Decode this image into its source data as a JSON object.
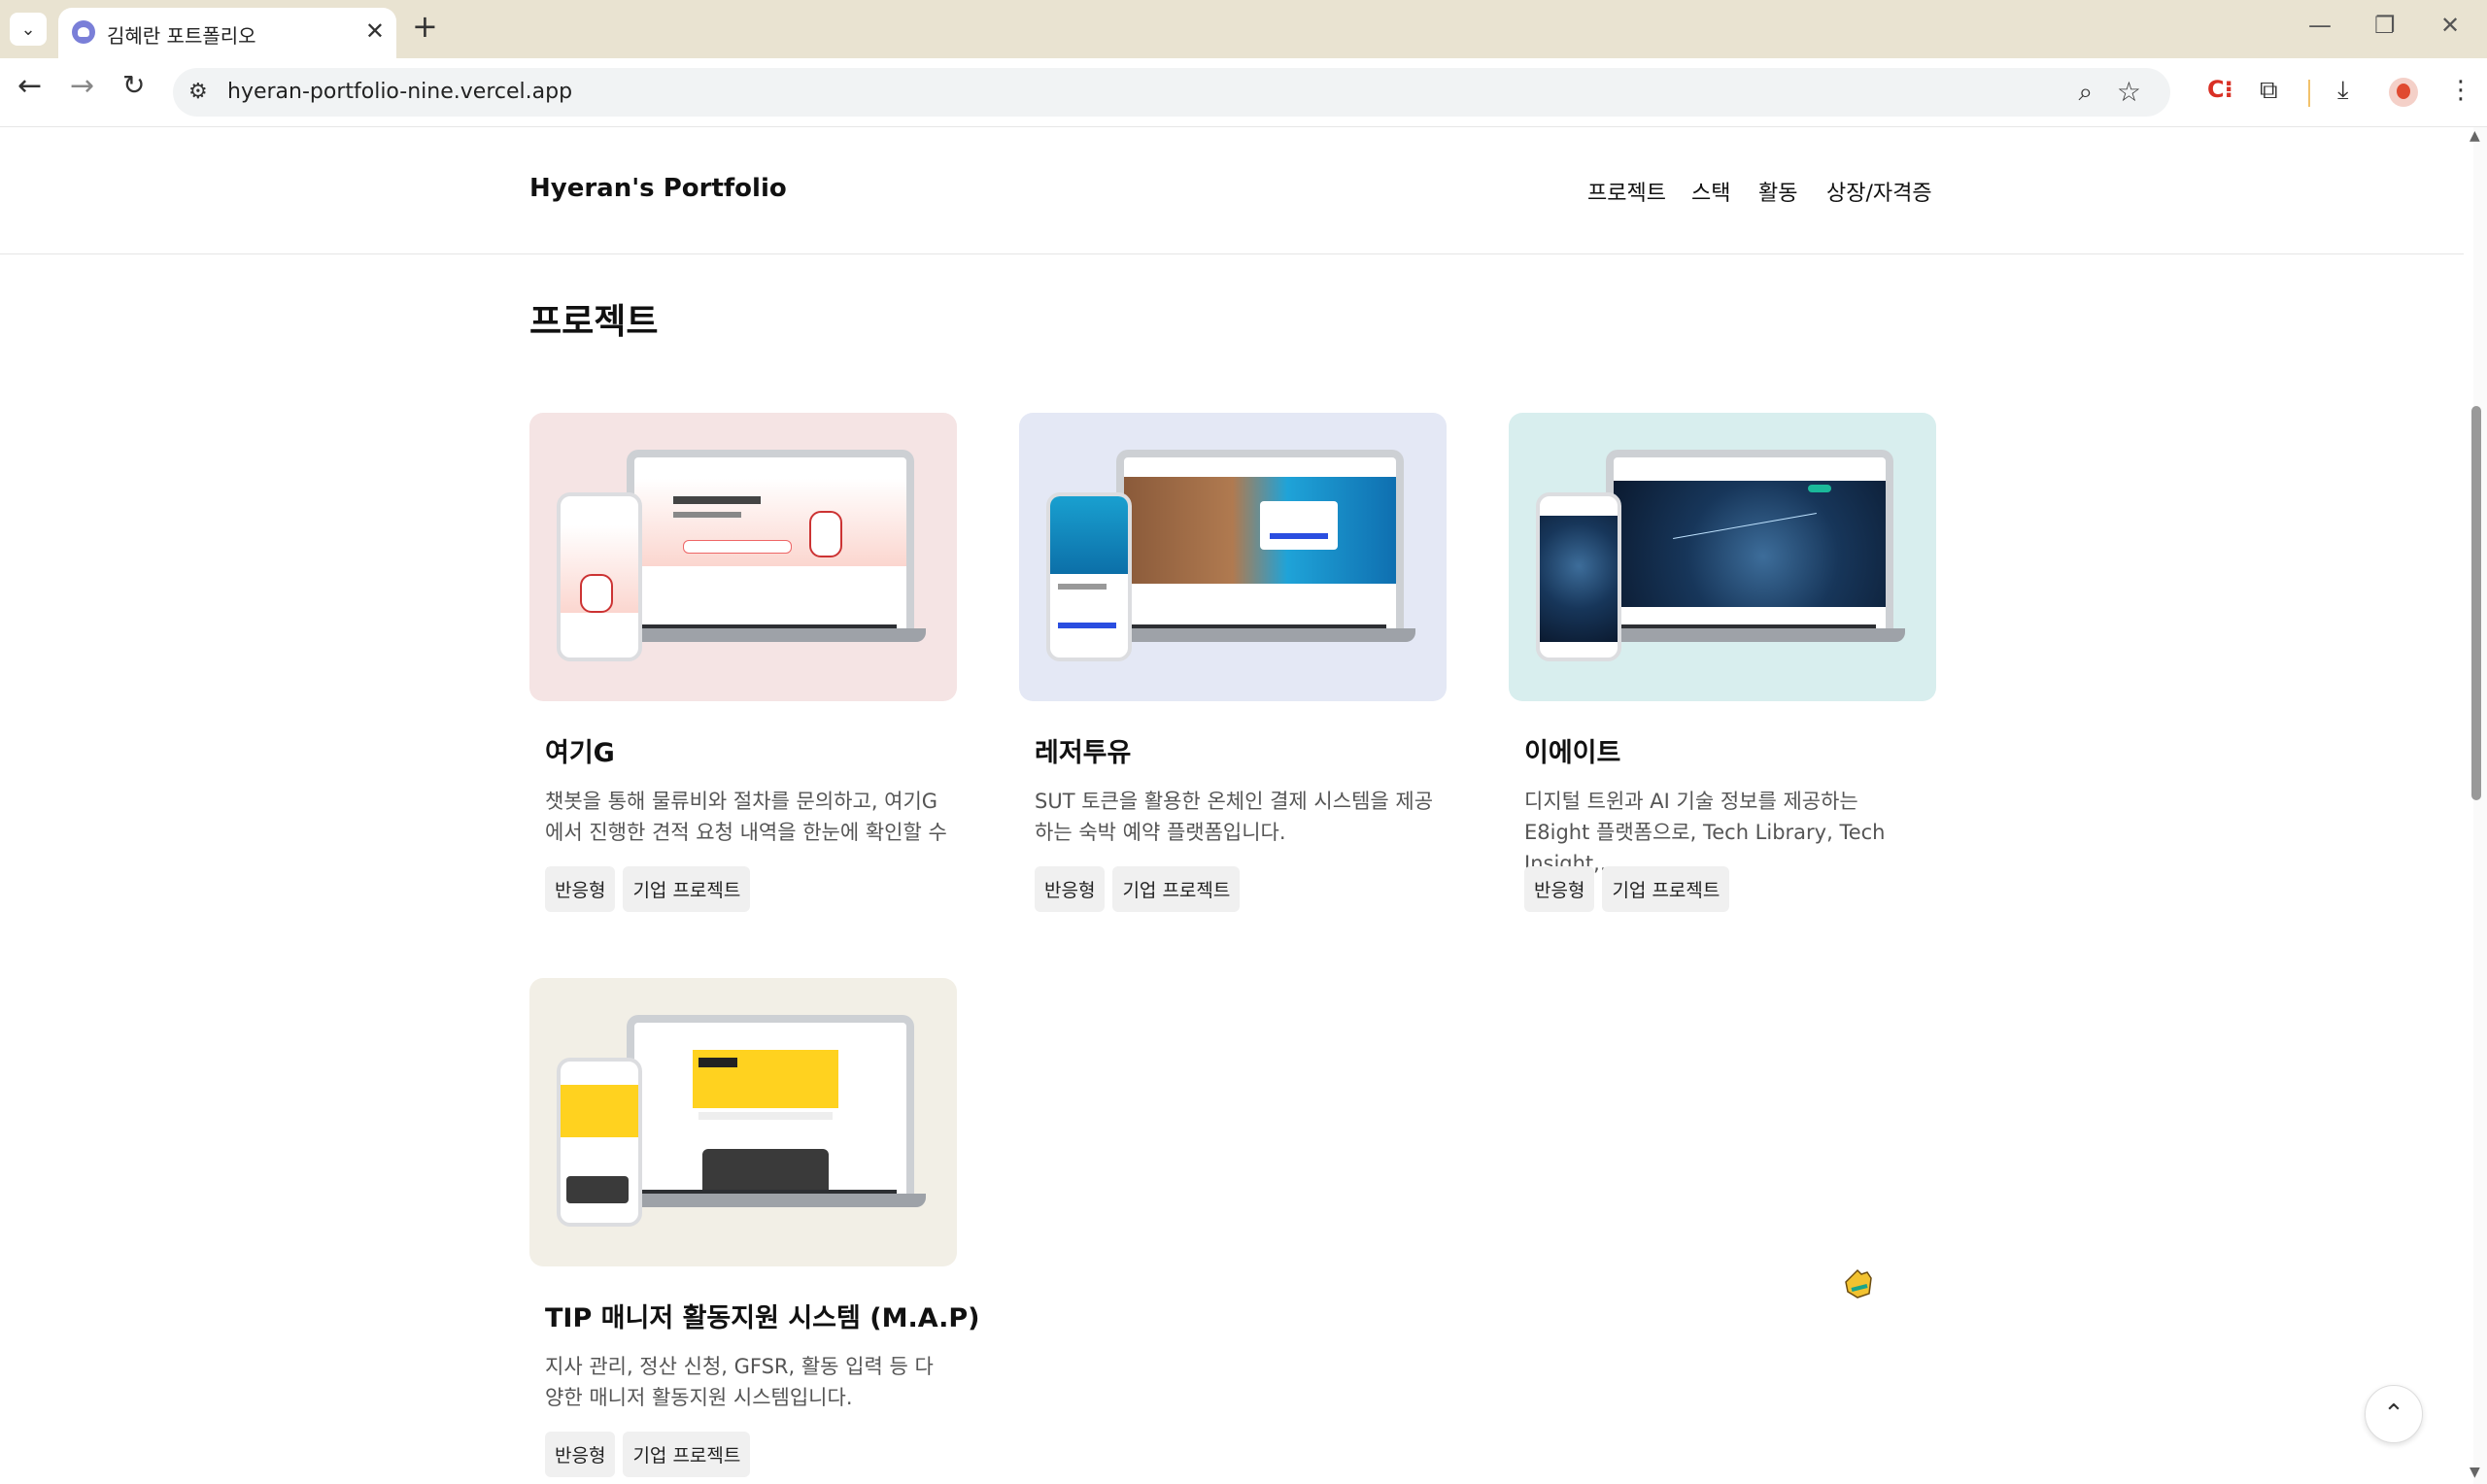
{
  "browser": {
    "tab_title": "김혜란 포트폴리오",
    "url": "hyeran-portfolio-nine.vercel.app",
    "icons": {
      "tab_menu": "chevron-down-icon",
      "close": "close-icon",
      "new_tab": "plus-icon",
      "back": "arrow-left-icon",
      "forward": "arrow-right-icon",
      "reload": "reload-icon",
      "site_info": "tune-icon",
      "zoom": "zoom-icon",
      "bookmark": "star-icon",
      "extensions": "puzzle-icon",
      "download": "download-icon",
      "menu": "kebab-menu-icon"
    }
  },
  "header": {
    "logo": "Hyeran's Portfolio",
    "nav": [
      "프로젝트",
      "스택",
      "활동",
      "상장/자격증"
    ]
  },
  "section": {
    "title": "프로젝트"
  },
  "projects": [
    {
      "title": "여기G",
      "description": "챗봇을 통해 물류비와 절차를 문의하고, 여기G에서 진행한 견적 요청 내역을 한눈에 확인할 수 ...",
      "tags": [
        "반응형",
        "기업 프로젝트"
      ],
      "thumb_bg": "#f5e4e4"
    },
    {
      "title": "레저투유",
      "description": "SUT 토큰을 활용한 온체인 결제 시스템을 제공하는 숙박 예약 플랫폼입니다.",
      "tags": [
        "반응형",
        "기업 프로젝트"
      ],
      "thumb_bg": "#e4e8f5"
    },
    {
      "title": "이에이트",
      "description": "디지털 트윈과 AI 기술 정보를 제공하는 E8ight 플랫폼으로, Tech Library, Tech Insight,...",
      "tags": [
        "반응형",
        "기업 프로젝트"
      ],
      "thumb_bg": "#d8eeee"
    },
    {
      "title": "TIP 매니저 활동지원 시스템 (M.A.P)",
      "description": "지사 관리, 정산 신청, GFSR, 활동 입력 등 다양한 매니저 활동지원 시스템입니다.",
      "tags": [
        "반응형",
        "기업 프로젝트"
      ],
      "thumb_bg": "#f2efe6"
    }
  ],
  "scroll_top_icon": "chevron-up-icon",
  "colors": {
    "tabbar": "#e9e3d1",
    "accent_red": "#d93025"
  }
}
